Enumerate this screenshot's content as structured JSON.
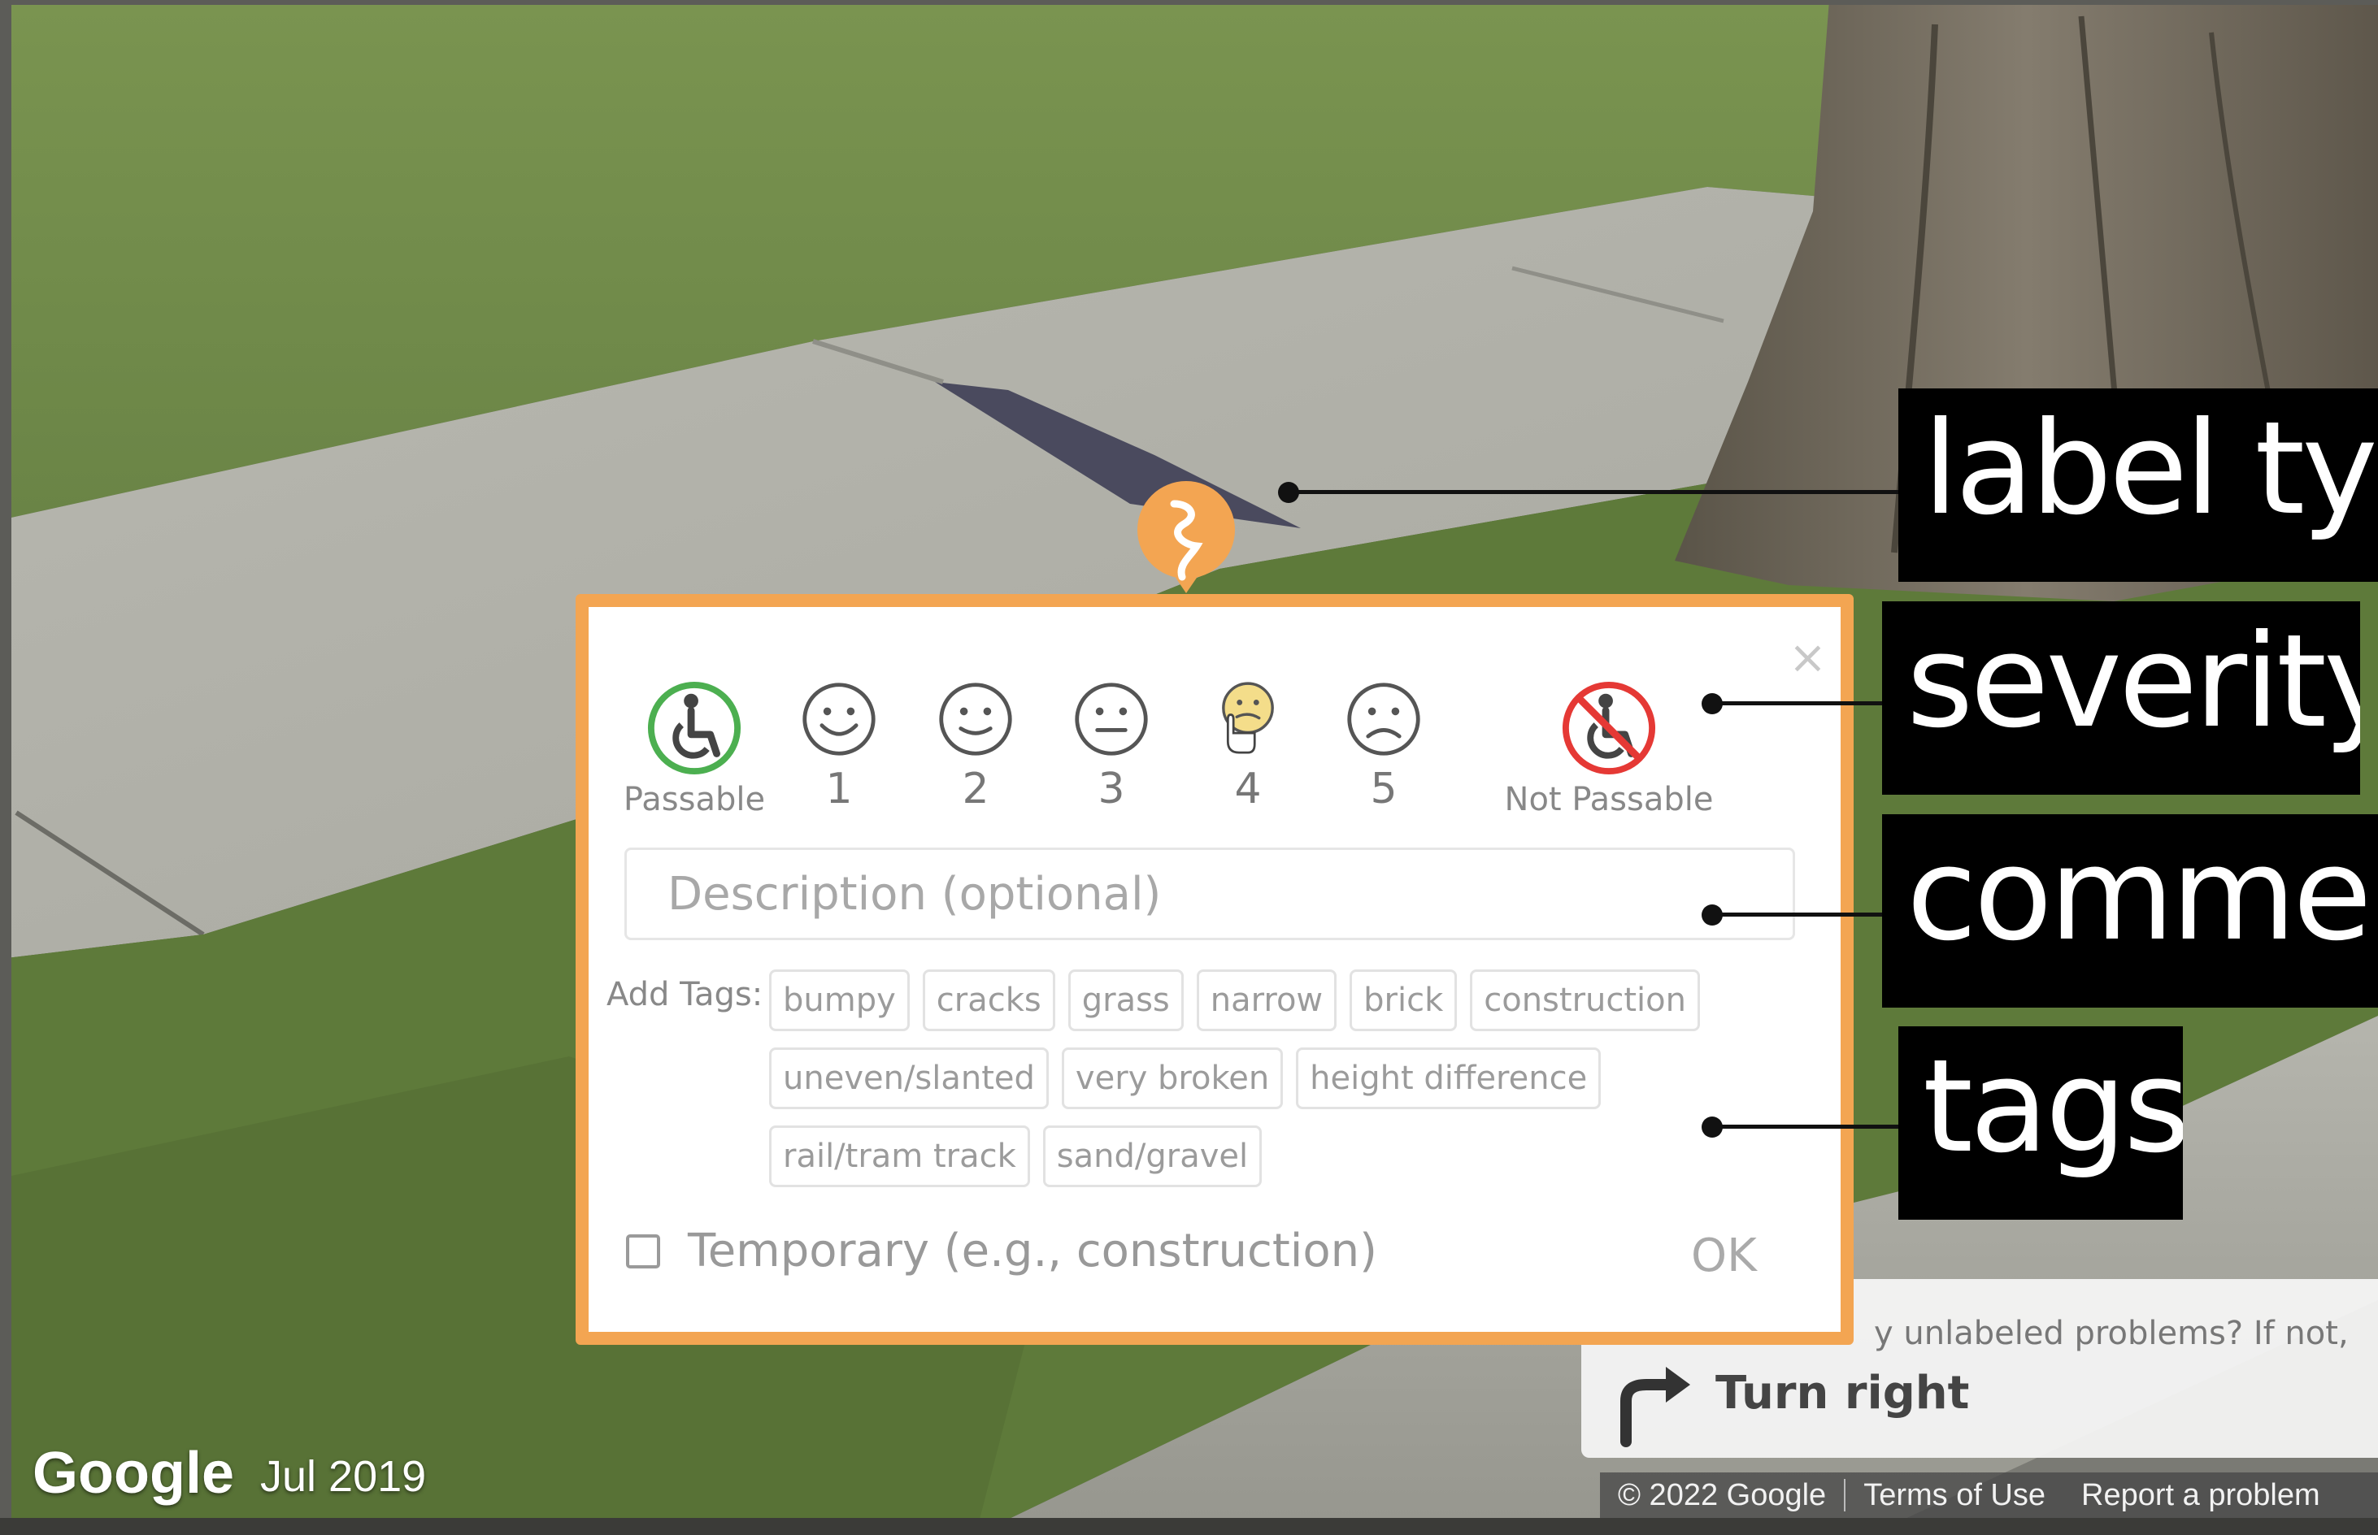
{
  "streetview": {
    "logo": "Google",
    "date": "Jul 2019",
    "copyright": "© 2022 Google",
    "terms": "Terms of Use",
    "report": "Report a problem"
  },
  "navigation": {
    "hint": "y unlabeled problems? If not,",
    "instruction": "Turn right",
    "icon": "turn-right-arrow-icon"
  },
  "label_pin": {
    "icon": "surface-problem-icon",
    "color": "#f3a552"
  },
  "popup": {
    "close": "×",
    "severity": {
      "passable": "Passable",
      "levels": [
        "1",
        "2",
        "3",
        "4",
        "5"
      ],
      "not_passable": "Not Passable",
      "highlighted_level": "4"
    },
    "description_placeholder": "Description (optional)",
    "add_tags_label": "Add Tags:",
    "tags": [
      "bumpy",
      "cracks",
      "grass",
      "narrow",
      "brick",
      "construction",
      "uneven/slanted",
      "very broken",
      "height difference",
      "rail/tram track",
      "sand/gravel"
    ],
    "temporary_label": "Temporary (e.g., construction)",
    "ok": "OK"
  },
  "callouts": {
    "label_type": "label typ",
    "severity": "severity",
    "comment": "comment",
    "tags": "tags"
  },
  "colors": {
    "popup_border": "#f3a552",
    "passable_ring": "#4caf50",
    "not_passable_ring": "#e53935",
    "callout_bg": "#000000"
  }
}
